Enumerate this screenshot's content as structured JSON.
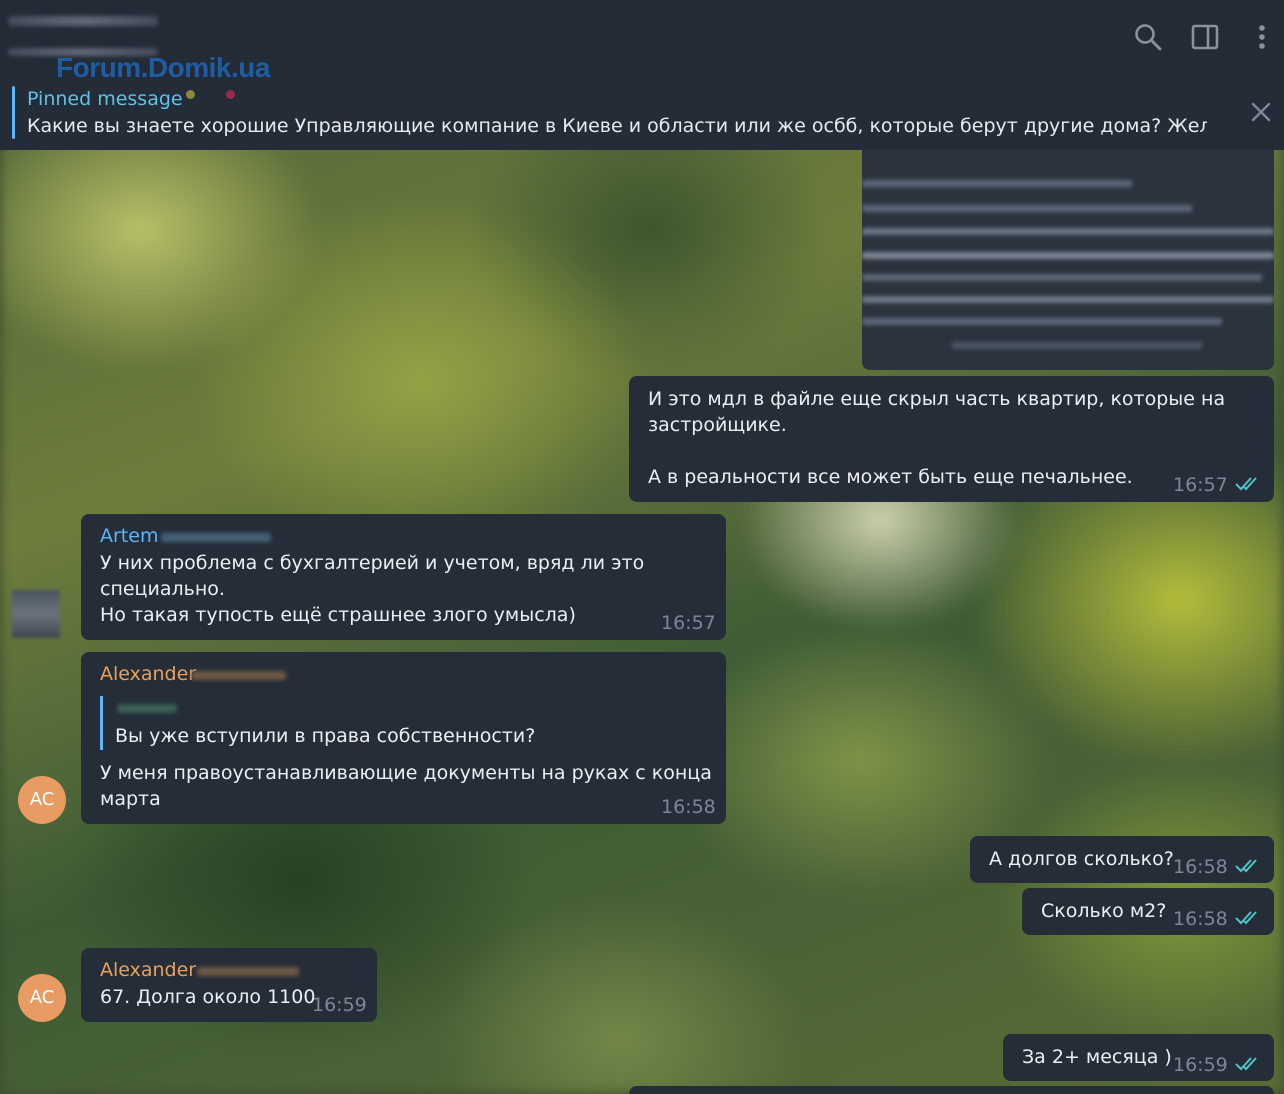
{
  "header": {
    "watermark": "Forum.Domik.ua"
  },
  "pinned": {
    "title": "Pinned message",
    "text": "Какие вы знаете хорошие Управляющие компание в Киеве и области или же осбб, которые берут другие дома?   Желатель..."
  },
  "messages": {
    "m1": {
      "line1": "И это мдл в файле еще скрыл часть квартир, которые на",
      "line2": "застройщике.",
      "line3": "А в реальности все может быть еще печальнее.",
      "time": "16:57"
    },
    "m2": {
      "sender": "Artem",
      "line1": "У них проблема с бухгалтерией и учетом, вряд ли это",
      "line2": "специально.",
      "line3": "Но такая тупость ещё страшнее злого умысла)",
      "time": "16:57"
    },
    "m3": {
      "sender": "Alexander",
      "quote": "Вы уже вступили в права собственности?",
      "line1": "У меня правоустанавливающие документы на руках с конца",
      "line2": "марта",
      "time": "16:58",
      "avatar": "AC"
    },
    "m4": {
      "text": "А долгов сколько?",
      "time": "16:58"
    },
    "m5": {
      "text": "Сколько м2?",
      "time": "16:58"
    },
    "m6": {
      "sender": "Alexander",
      "text": "67. Долга около 1100",
      "time": "16:59",
      "avatar": "AC"
    },
    "m7": {
      "text": "За 2+ месяца )",
      "time": "16:59"
    }
  },
  "colors": {
    "bubble": "#252d38",
    "sender_artem": "#5eb5f7",
    "sender_alexander": "#e9a15c",
    "check": "#4fc3c8",
    "avatar": "#e89b63"
  },
  "icons": [
    "search-icon",
    "sidebar-toggle-icon",
    "more-vert-icon",
    "close-icon",
    "double-check-icon"
  ]
}
